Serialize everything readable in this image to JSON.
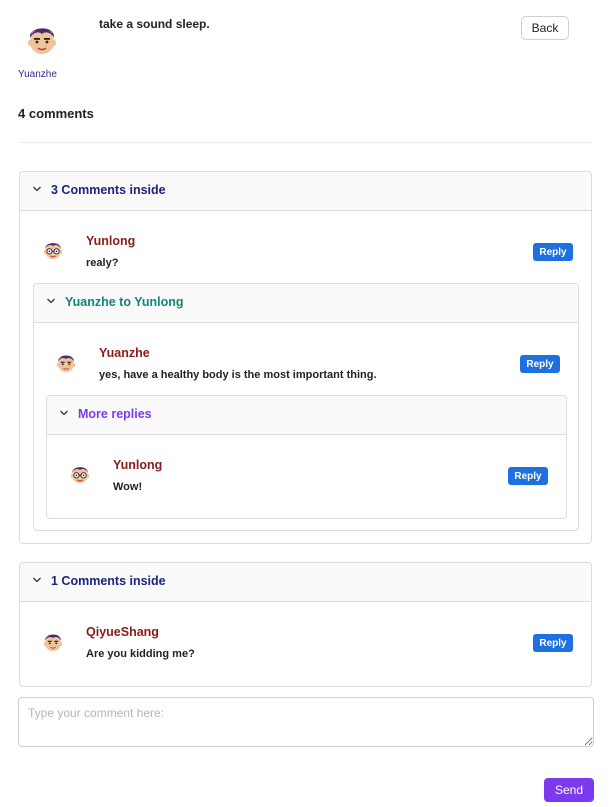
{
  "post": {
    "author": "Yuanzhe",
    "text": "take a sound sleep.",
    "back_label": "Back"
  },
  "comments_count_label": "4 comments",
  "threads": [
    {
      "title": "3 Comments inside",
      "comment": {
        "author": "Yunlong",
        "text": "realy?",
        "reply_label": "Reply"
      },
      "sub": {
        "title": "Yuanzhe to Yunlong",
        "comment": {
          "author": "Yuanzhe",
          "text": "yes, have a healthy body is the most important thing.",
          "reply_label": "Reply"
        },
        "more": {
          "title": "More replies",
          "comment": {
            "author": "Yunlong",
            "text": "Wow!",
            "reply_label": "Reply"
          }
        }
      }
    },
    {
      "title": "1 Comments inside",
      "comment": {
        "author": "QiyueShang",
        "text": "Are you kidding me?",
        "reply_label": "Reply"
      }
    }
  ],
  "composer": {
    "placeholder": "Type your comment here:",
    "value": "",
    "send_label": "Send"
  },
  "colors": {
    "reply_button": "#1e6fe0",
    "send_button": "#7c3aed",
    "author_name": "#8b1a1a",
    "thread_title": "#1a237e",
    "sub_thread_title": "#12857a",
    "more_replies_title": "#7c3aed"
  },
  "icons": {
    "avatar": "cartoon-face-avatar",
    "avatar_glasses": "cartoon-face-avatar-glasses",
    "expand": "chevron-down-icon"
  }
}
